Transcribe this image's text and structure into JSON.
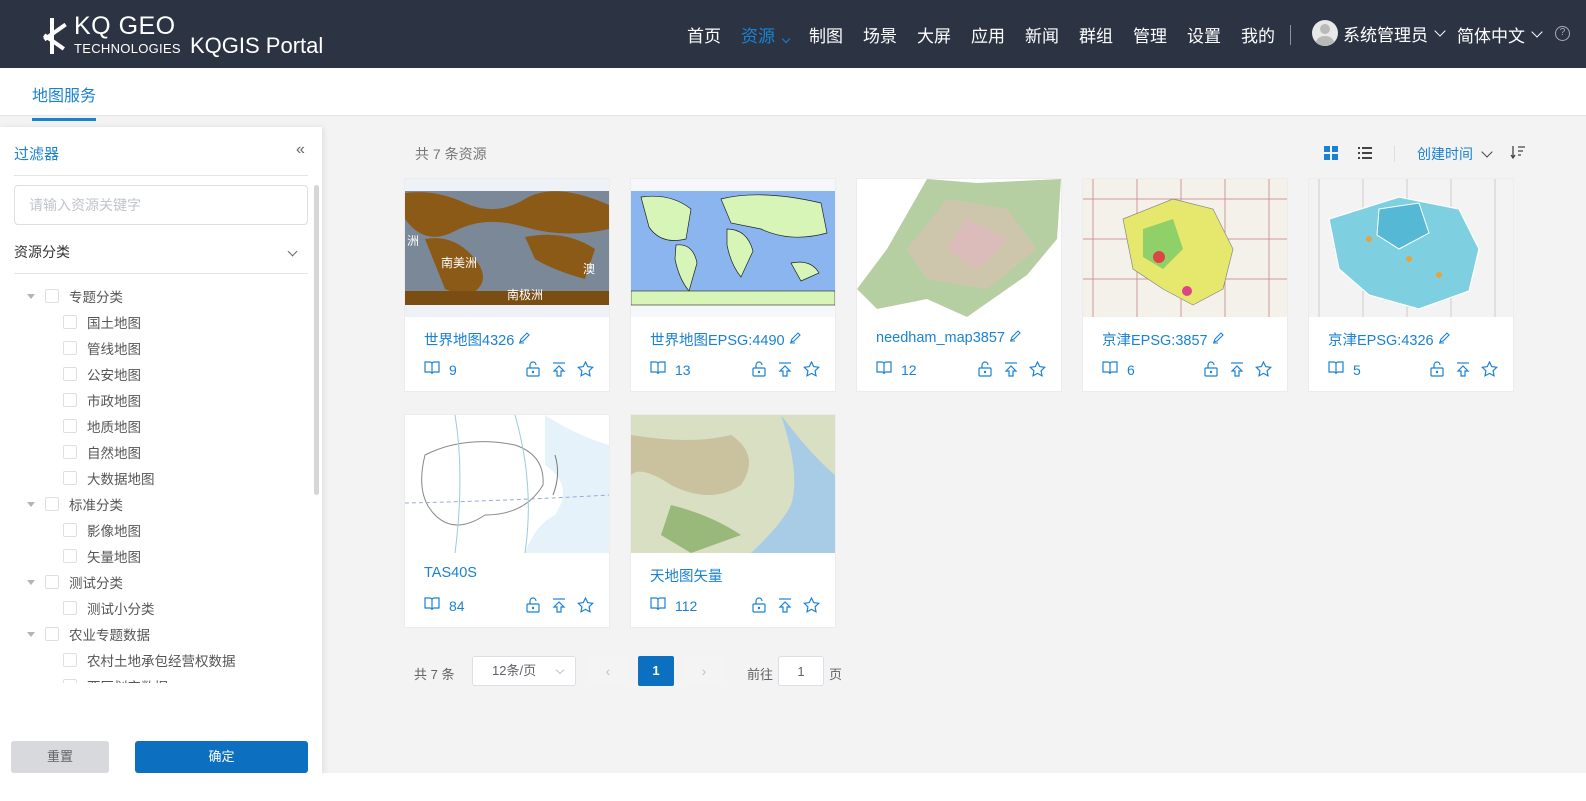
{
  "header": {
    "logo_big": "KQ GEO",
    "logo_small": "TECHNOLOGIES",
    "portal_name": "KQGIS Portal",
    "nav": [
      {
        "label": "首页",
        "active": false
      },
      {
        "label": "资源",
        "active": true,
        "has_dropdown": true
      },
      {
        "label": "制图",
        "active": false
      },
      {
        "label": "场景",
        "active": false
      },
      {
        "label": "大屏",
        "active": false
      },
      {
        "label": "应用",
        "active": false
      },
      {
        "label": "新闻",
        "active": false
      },
      {
        "label": "群组",
        "active": false
      },
      {
        "label": "管理",
        "active": false
      },
      {
        "label": "设置",
        "active": false
      },
      {
        "label": "我的",
        "active": false
      }
    ],
    "user_name": "系统管理员",
    "language": "简体中文",
    "help": "?"
  },
  "tabs": {
    "active": "地图服务"
  },
  "sidebar": {
    "title": "过滤器",
    "collapse": "«",
    "search_placeholder": "请输入资源关键字",
    "category_label": "资源分类",
    "tree": [
      {
        "label": "专题分类",
        "level": 0
      },
      {
        "label": "国土地图",
        "level": 1
      },
      {
        "label": "管线地图",
        "level": 1
      },
      {
        "label": "公安地图",
        "level": 1
      },
      {
        "label": "市政地图",
        "level": 1
      },
      {
        "label": "地质地图",
        "level": 1
      },
      {
        "label": "自然地图",
        "level": 1
      },
      {
        "label": "大数据地图",
        "level": 1
      },
      {
        "label": "标准分类",
        "level": 0
      },
      {
        "label": "影像地图",
        "level": 1
      },
      {
        "label": "矢量地图",
        "level": 1
      },
      {
        "label": "测试分类",
        "level": 0
      },
      {
        "label": "测试小分类",
        "level": 1
      },
      {
        "label": "农业专题数据",
        "level": 0
      },
      {
        "label": "农村土地承包经营权数据",
        "level": 1
      },
      {
        "label": "西区划定数据",
        "level": 1
      }
    ],
    "reset_label": "重置",
    "confirm_label": "确定"
  },
  "main": {
    "count_text": "共 7 条资源",
    "sort_label": "创建时间",
    "cards": [
      {
        "title": "世界地图4326",
        "views": "9",
        "editable": true,
        "thumb": "world-dark"
      },
      {
        "title": "世界地图EPSG:4490",
        "views": "13",
        "editable": true,
        "thumb": "world-blue"
      },
      {
        "title": "needham_map3857",
        "views": "12",
        "editable": true,
        "thumb": "terrain"
      },
      {
        "title": "京津EPSG:3857",
        "views": "6",
        "editable": true,
        "thumb": "jingjin-yellow"
      },
      {
        "title": "京津EPSG:4326",
        "views": "5",
        "editable": true,
        "thumb": "jingjin-cyan"
      },
      {
        "title": "TAS40S",
        "views": "84",
        "editable": false,
        "thumb": "asia-outline"
      },
      {
        "title": "天地图矢量",
        "views": "112",
        "editable": false,
        "thumb": "asia-sat"
      }
    ]
  },
  "pagination": {
    "total": "共 7 条",
    "page_size": "12条/页",
    "current": "1",
    "goto_label": "前往",
    "goto_value": "1",
    "page_suffix": "页"
  },
  "colors": {
    "header_bg": "#2c3444",
    "accent": "#1b82d2",
    "primary_button": "#0d6fc0"
  }
}
